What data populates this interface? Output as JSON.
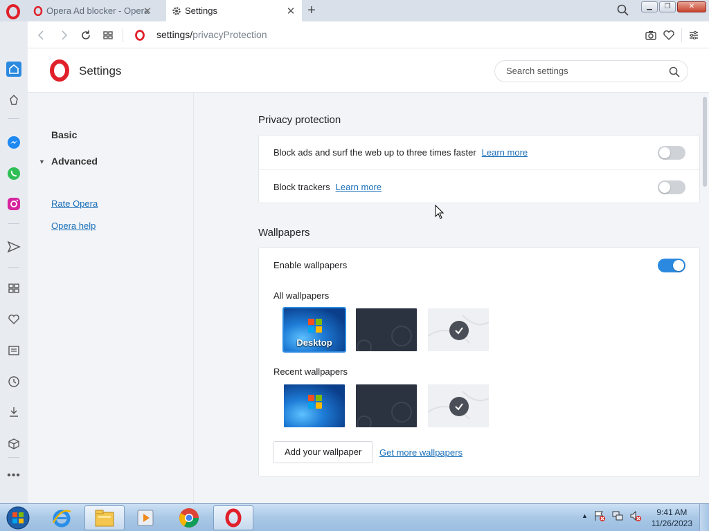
{
  "browser": {
    "tabs": [
      {
        "title": "Opera Ad blocker - Opera",
        "active": false
      },
      {
        "title": "Settings",
        "active": true
      }
    ],
    "address": {
      "prefix": "settings/",
      "path": "privacyProtection"
    }
  },
  "settings": {
    "title": "Settings",
    "search_placeholder": "Search settings",
    "nav": {
      "basic": "Basic",
      "advanced": "Advanced",
      "rate": "Rate Opera",
      "help": "Opera help"
    },
    "privacy": {
      "title": "Privacy protection",
      "rows": [
        {
          "label": "Block ads and surf the web up to three times faster",
          "link": "Learn more",
          "enabled": false
        },
        {
          "label": "Block trackers",
          "link": "Learn more",
          "enabled": false
        }
      ]
    },
    "wallpapers": {
      "title": "Wallpapers",
      "enable_label": "Enable wallpapers",
      "enabled": true,
      "all_label": "All wallpapers",
      "recent_label": "Recent wallpapers",
      "desktop_label": "Desktop",
      "add_button": "Add your wallpaper",
      "get_more": "Get more wallpapers"
    }
  },
  "taskbar": {
    "time": "9:41 AM",
    "date": "11/26/2023"
  },
  "colors": {
    "accent": "#2b8ae0",
    "opera_red": "#e0202a",
    "link": "#1a6fb8"
  }
}
